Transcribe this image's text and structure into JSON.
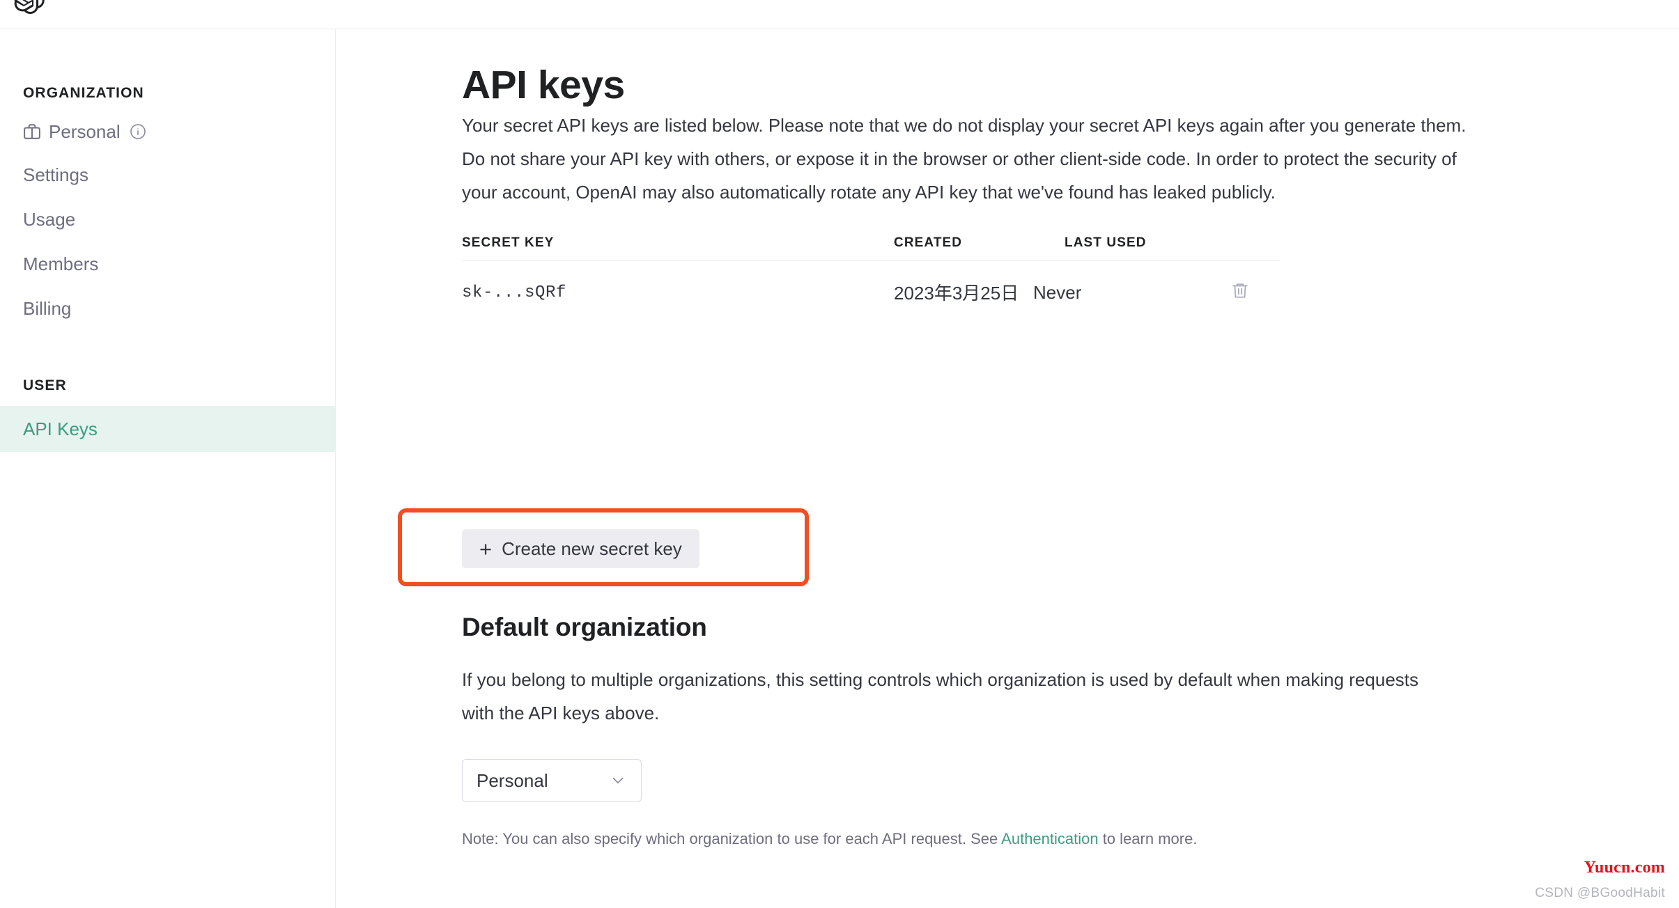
{
  "topbar": {
    "logo_icon": "openai-logo-icon"
  },
  "sidebar": {
    "org_section_label": "ORGANIZATION",
    "user_section_label": "USER",
    "org_items": [
      {
        "label": "Personal",
        "icon": "briefcase-icon",
        "info_icon": "info-circle-icon",
        "active": false
      },
      {
        "label": "Settings",
        "active": false
      },
      {
        "label": "Usage",
        "active": false
      },
      {
        "label": "Members",
        "active": false
      },
      {
        "label": "Billing",
        "active": false
      }
    ],
    "user_items": [
      {
        "label": "API Keys",
        "active": true
      }
    ],
    "active_bg_color": "#e6f3ef",
    "active_text_color": "#3b9d7f"
  },
  "main": {
    "page_title": "API keys",
    "paragraph_1": "Your secret API keys are listed below. Please note that we do not display your secret API keys again after you generate them.",
    "paragraph_2": "Do not share your API key with others, or expose it in the browser or other client-side code. In order to protect the security of your account, OpenAI may also automatically rotate any API key that we've found has leaked publicly.",
    "table": {
      "columns": [
        "SECRET KEY",
        "CREATED",
        "LAST USED"
      ],
      "rows": [
        {
          "secret_key": "sk-...sQRf",
          "created": "2023年3月25日",
          "last_used": "Never",
          "delete_icon": "trash-icon"
        }
      ]
    },
    "create_button": {
      "label": "Create new secret key",
      "plus_glyph": "+",
      "highlight_color": "#f04e23"
    },
    "default_org": {
      "title": "Default organization",
      "description": "If you belong to multiple organizations, this setting controls which organization is used by default when making requests with the API keys above.",
      "select_value": "Personal",
      "select_chevron_icon": "chevron-down-icon",
      "note_prefix": "Note: You can also specify which organization to use for each API request. See ",
      "note_link": "Authentication",
      "note_suffix": " to learn more."
    }
  },
  "watermark": {
    "primary": "Yuucn.com",
    "secondary": "CSDN @BGoodHabit",
    "primary_color": "#e8111e"
  }
}
